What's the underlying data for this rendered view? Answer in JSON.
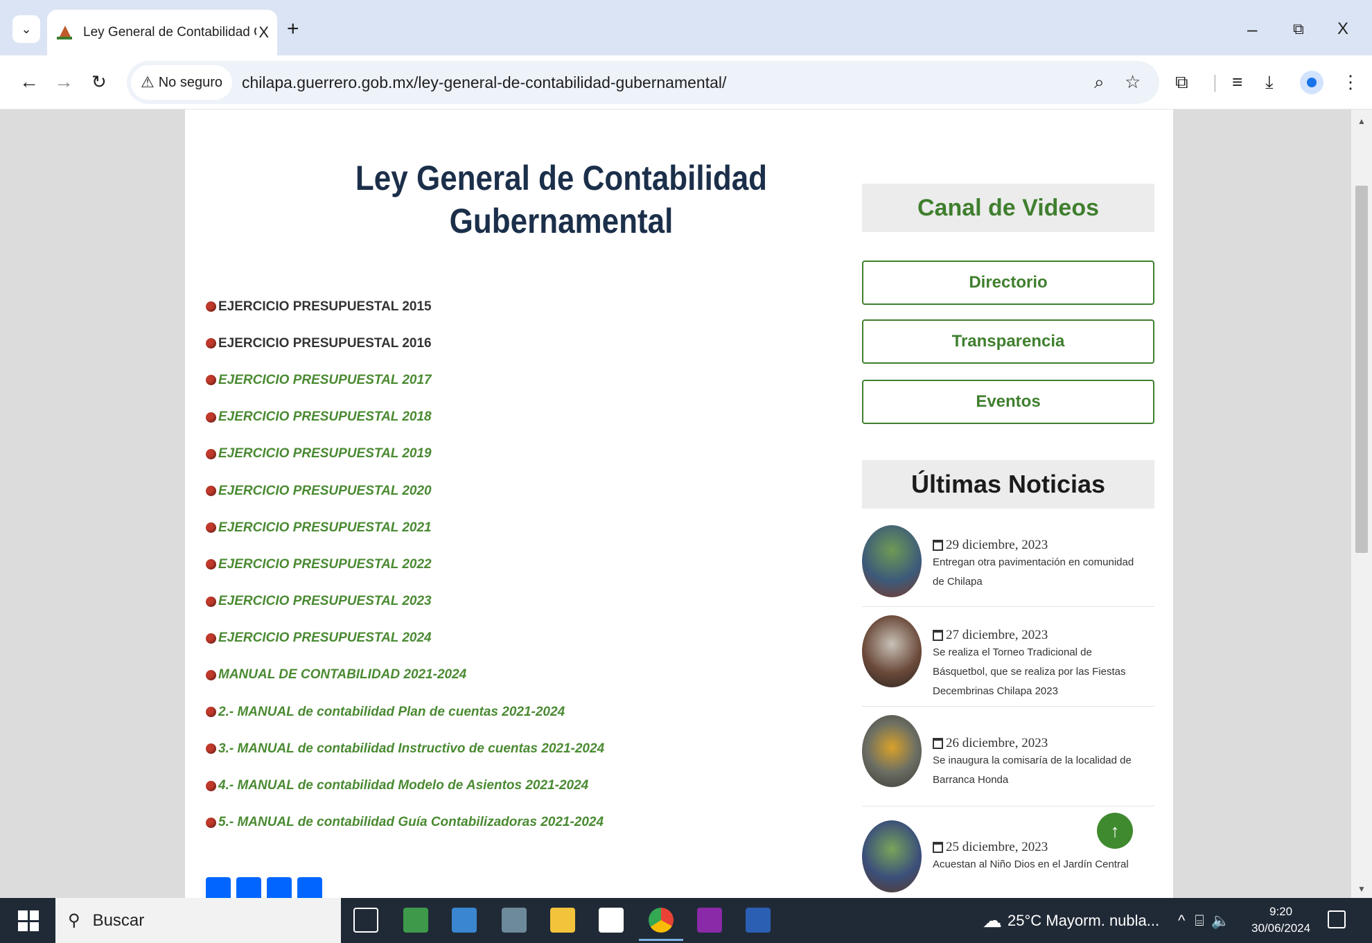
{
  "browser": {
    "tab_title": "Ley General de Contabilidad Gubernamental",
    "tab_menu_icon": "chevron-down-icon",
    "new_tab": "+",
    "close_tab": "X",
    "window_minimize": "–",
    "window_restore": "⧉",
    "window_close": "X",
    "security_label": "No seguro",
    "url": "chilapa.guerrero.gob.mx/ley-general-de-contabilidad-gubernamental/"
  },
  "page": {
    "title": "Ley General de Contabilidad Gubernamental",
    "documents": [
      {
        "label": "EJERCICIO PRESUPUESTAL 2015",
        "link": false
      },
      {
        "label": "EJERCICIO PRESUPUESTAL 2016",
        "link": false
      },
      {
        "label": "EJERCICIO PRESUPUESTAL  2017",
        "link": true
      },
      {
        "label": "EJERCICIO PRESUPUESTAL 2018",
        "link": true
      },
      {
        "label": "EJERCICIO PRESUPUESTAL 2019",
        "link": true
      },
      {
        "label": "EJERCICIO PRESUPUESTAL 2020",
        "link": true
      },
      {
        "label": "EJERCICIO PRESUPUESTAL 2021",
        "link": true
      },
      {
        "label": "EJERCICIO PRESUPUESTAL 2022",
        "link": true
      },
      {
        "label": "EJERCICIO PRESUPUESTAL 2023",
        "link": true
      },
      {
        "label": "EJERCICIO PRESUPUESTAL 2024",
        "link": true
      },
      {
        "label": "MANUAL DE CONTABILIDAD 2021-2024",
        "link": true
      },
      {
        "label": "2.- MANUAL de contabilidad Plan de cuentas 2021-2024",
        "link": true
      },
      {
        "label": "3.- MANUAL de contabilidad Instructivo de cuentas 2021-2024",
        "link": true
      },
      {
        "label": "4.- MANUAL de contabilidad Modelo de Asientos 2021-2024",
        "link": true
      },
      {
        "label": "5.- MANUAL de contabilidad Guía Contabilizadoras 2021-2024",
        "link": true
      }
    ]
  },
  "sidebar": {
    "videos_title": "Canal de Videos",
    "buttons": [
      "Directorio",
      "Transparencia",
      "Eventos"
    ],
    "news_title": "Últimas Noticias",
    "news": [
      {
        "date": "29 diciembre, 2023",
        "headline": "Entregan otra pavimentación en comunidad de Chilapa"
      },
      {
        "date": "27 diciembre, 2023",
        "headline": "Se realiza el Torneo Tradicional de Básquetbol, que se realiza por las Fiestas Decembrinas Chilapa 2023"
      },
      {
        "date": "26 diciembre, 2023",
        "headline": "Se inaugura la comisaría de la localidad de Barranca Honda"
      },
      {
        "date": "25 diciembre, 2023",
        "headline": "Acuestan al Niño Dios en el Jardín Central"
      }
    ]
  },
  "back_to_top": "↑",
  "taskbar": {
    "search_label": "Buscar",
    "weather": "25°C  Mayorm. nubla...",
    "time": "9:20",
    "date": "30/06/2024"
  }
}
